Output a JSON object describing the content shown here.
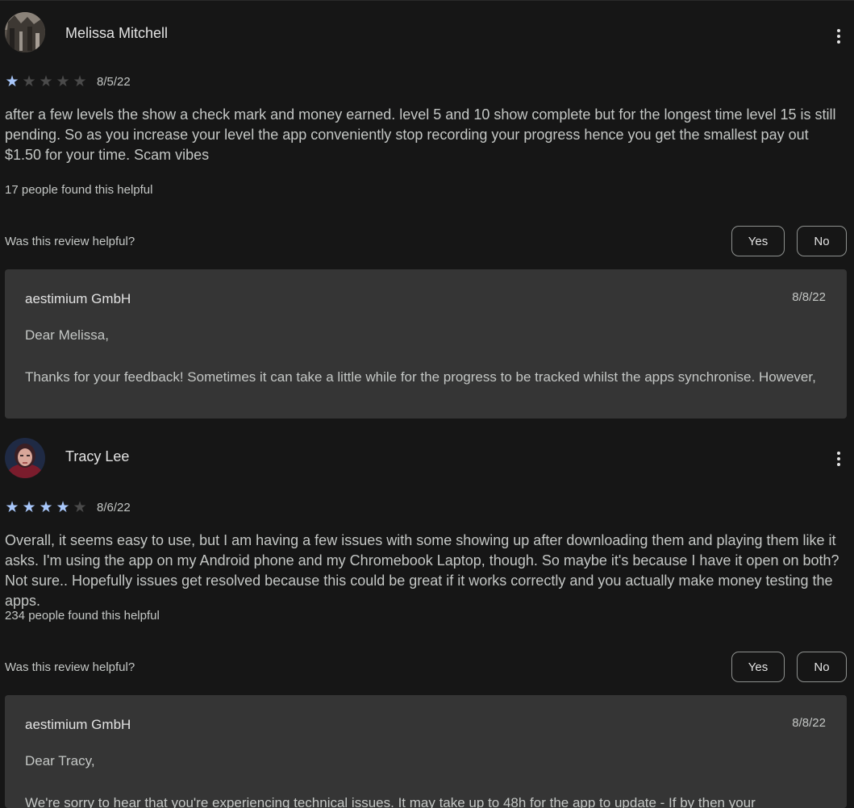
{
  "reviews": [
    {
      "name": "Melissa Mitchell",
      "rating": 1,
      "max_rating": 5,
      "date": "8/5/22",
      "text": "after a few levels the show a check mark and money earned. level 5 and 10 show complete but for the longest time level 15 is still pending. So as you increase your level the app conveniently stop recording your progress hence you get the smallest pay out $1.50 for your time. Scam vibes",
      "helpful_count": "17 people found this helpful",
      "helpful_question": "Was this review helpful?",
      "yes_label": "Yes",
      "no_label": "No",
      "avatar_icon": "avatar-photo-icon",
      "reply": {
        "developer": "aestimium GmbH",
        "date": "8/8/22",
        "greeting": "Dear Melissa,",
        "body": "Thanks for your feedback! Sometimes it can take a little while for the progress to be tracked whilst the apps synchronise. However,"
      }
    },
    {
      "name": "Tracy Lee",
      "rating": 4,
      "max_rating": 5,
      "date": "8/6/22",
      "text": "Overall, it seems easy to use, but I am having a few issues with some showing up after downloading them and playing them like it asks. I'm using the app on my Android phone and my Chromebook Laptop, though. So maybe it's because I have it open on both? Not sure.. Hopefully issues get resolved because this could be great if it works correctly and you actually make money testing the apps.",
      "helpful_count": "234 people found this helpful",
      "helpful_question": "Was this review helpful?",
      "yes_label": "Yes",
      "no_label": "No",
      "avatar_icon": "avatar-photo-icon",
      "reply": {
        "developer": "aestimium GmbH",
        "date": "8/8/22",
        "greeting": "Dear Tracy,",
        "body": "We're sorry to hear that you're experiencing technical issues. It may take up to 48h for the app to update - If by then your"
      }
    }
  ],
  "colors": {
    "background": "#161616",
    "star_on": "#a8c7fa",
    "star_off": "#4a4a4a",
    "reply_bg": "#353535"
  },
  "icons": {
    "more": "more-vert-icon",
    "star": "star-icon"
  }
}
